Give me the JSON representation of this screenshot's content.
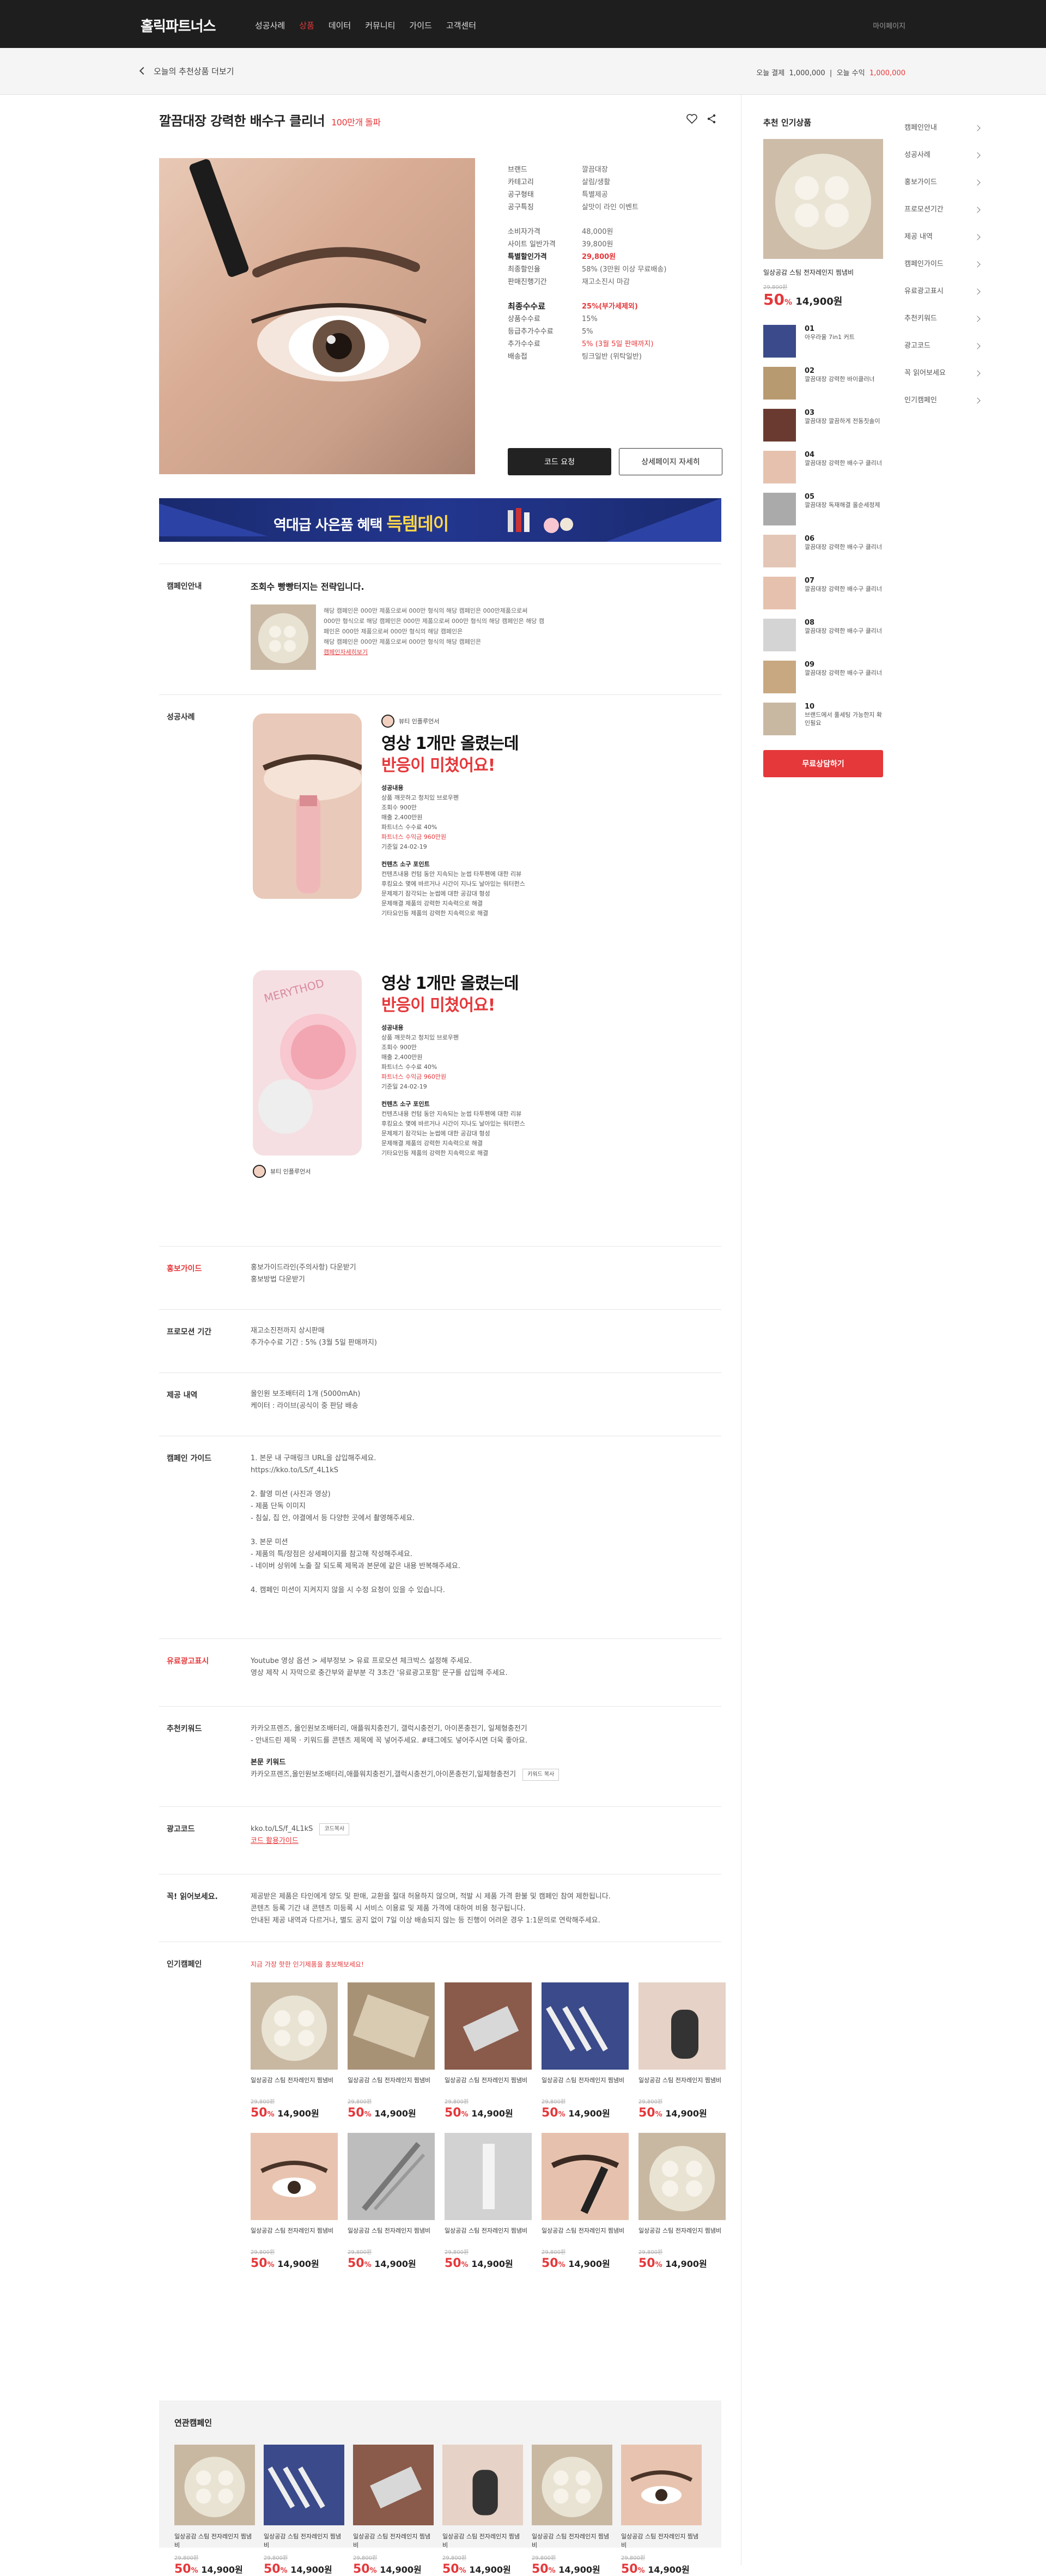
{
  "header": {
    "logo": "홀릭파트너스",
    "nav": [
      "성공사례",
      "상품",
      "데이터",
      "커뮤니티",
      "가이드",
      "고객센터"
    ],
    "active_nav": "상품",
    "login": "마이페이지"
  },
  "subbar": {
    "back_label": "오늘의 추천상품 더보기",
    "balance_label": "오늘 결제",
    "balance_value": "1,000,000",
    "today_label": "오늘 수익",
    "today_value": "1,000,000"
  },
  "product": {
    "title": "깔끔대장 강력한 배수구 클리너",
    "subtitle": "100만개 돌파",
    "info1": [
      {
        "k": "브랜드",
        "v": "깔끔대장"
      },
      {
        "k": "카테고리",
        "v": "살림/생활"
      },
      {
        "k": "공구형태",
        "v": "특별제공"
      },
      {
        "k": "공구특징",
        "v": "살맛이 라인 이벤트"
      }
    ],
    "info2": [
      {
        "k": "소비자가격",
        "v": "48,000원"
      },
      {
        "k": "사이트 일반가격",
        "v": "39,800원"
      },
      {
        "k": "특별할인가격",
        "v": "29,800원"
      },
      {
        "k": "최종할인율",
        "v": "58% (3만원 이상 무료배송)"
      },
      {
        "k": "판매진행기간",
        "v": "재고소진시 마감"
      }
    ],
    "info3": [
      {
        "k": "최종수수료",
        "v": "25%(부가세제외)"
      },
      {
        "k": "상품수수료",
        "v": "15%"
      },
      {
        "k": "등급추가수수료",
        "v": "5%"
      },
      {
        "k": "추가수수료",
        "v": "5% (3월 5일 판매까지)"
      },
      {
        "k": "배송접",
        "v": "팅크일반 (위탁일반)"
      }
    ],
    "btn_code": "코드 요청",
    "btn_detail": "상세페이지 자세히"
  },
  "banner": {
    "text": "역대급 사은품 혜택",
    "highlight": "득템데이"
  },
  "campaign": {
    "label": "캠페인안내",
    "title": "조회수 빵빵터지는 전략입니다.",
    "lines": [
      "해당 캠페인은 000만 제품으로써 000만 형식의 해당 캠페인은 000만제품으로써",
      "000만 형식으로 해당 캠페인은 000만 제품으로써 000만 형식의 해당 캠페인은 해당 캠",
      "페인은 000만 제품으로써 000만 형식의 해당 캠페인은",
      "해당 캠페인은 000만 제품으로써 000만 형식의 해당 캠페인은"
    ],
    "link": "캠페인자세히보기"
  },
  "success": {
    "label": "성공사례",
    "author": "뷰티 인플루언서",
    "cases": [
      {
        "hl1": "영상 1개만 올렸는데",
        "hl2": "반응이 미쳤어요!",
        "details_title": "성공내용",
        "details": [
          "상품   깨끗하고 청치있 브로우펜",
          "조회수   900만",
          "매출   2,400만원",
          "파트너스 수수료   40%"
        ],
        "red": [
          "파트너스 수익금   960만원"
        ],
        "date": "기준일   24-02-19",
        "point_title": "컨텐츠 소구 포인트",
        "points": [
          "컨텐츠내용 컨텀 동안 지속되는 눈썹 타투펜에 대한 리뷰",
          "후킹요소 몇에 바르거나 시간이 지나도 날아있는 워터펀스",
          "문제제기 잠각되는 눈썹에 대한 공감대 형성",
          "문제해결 제품의 강력한 지속력으로 해결",
          "기타요인등 제품의 강력한 지속력으로 해결"
        ]
      },
      {
        "hl1": "영상 1개만 올렸는데",
        "hl2": "반응이 미쳤어요!",
        "details_title": "성공내용",
        "details": [
          "상품   깨끗하고 청치있 브로우펜",
          "조회수   900만",
          "매출   2,400만원",
          "파트너스 수수료   40%"
        ],
        "red": [
          "파트너스 수익금   960만원"
        ],
        "date": "기준일   24-02-19",
        "point_title": "컨텐츠 소구 포인트",
        "points": [
          "컨텐츠내용 컨텀 동안 지속되는 눈썹 타투펜에 대한 리뷰",
          "후킹요소 몇에 바르거나 시간이 지나도 날아있는 워터펀스",
          "문제제기 잠각되는 눈썹에 대한 공감대 형성",
          "문제해결 제품의 강력한 지속력으로 해결",
          "기타요인등 제품의 강력한 지속력으로 해결"
        ]
      }
    ],
    "phone_top": "MERYTHOD"
  },
  "guide": {
    "label": "홍보가이드",
    "lines": [
      "홍보가이드라인(주의사항) 다운받기",
      "홍보방법 다운받기"
    ]
  },
  "promo": {
    "label": "프로모션 기간",
    "lines": [
      "재고소진전까지 상시판매",
      "추가수수료 기간 : 5% (3월 5일 판매까지)"
    ]
  },
  "provide": {
    "label": "제공 내역",
    "lines": [
      "올인원 보조배터리 1개 (5000mAh)",
      "케이터 : 라이브(공식이 중 판담 배송"
    ]
  },
  "campaign_guide": {
    "label": "캠페인 가이드",
    "lines": [
      "1. 본문 내 구매링크 URL을 삽입해주세요.",
      "https://kko.to/LS/f_4L1kS",
      "",
      "2. 촬영 미션 (사진과 영상)",
      "- 제품 단독 이미지",
      "- 침실, 집 안, 야결에서 등 다양한 곳에서 촬영해주세요.",
      "",
      "3. 본문 미션",
      "- 제품의 특/장점은 상세페이지를 참고해 작성해주세요.",
      "- 네이버 상위에 노출 잘 되도록 제목과 본문에 같은 내용 반복해주세요.",
      "",
      "4. 캠페인 미션이 지켜지지 않을 시 수정 요청이 있을 수 있습니다."
    ]
  },
  "ad_disclosure": {
    "label": "유료광고표시",
    "lines": [
      "Youtube 영상 옵션 > 세부정보 > 유료 프로모션 체크박스 설정해 주세요.",
      "영상 제작 시 자막으로 충간부와 끝부분 각 3초간 '유료광고포함' 문구를 삽입해 주세요."
    ]
  },
  "keywords": {
    "label": "추천키워드",
    "lines": [
      "카카오프렌즈, 올인원보조배터리, 애플워치충전기, 갤럭시충전기, 아이폰충전기, 일체형충전기",
      "- 안내드린 제목 · 키워드를 콘텐츠 제목에 꼭 넣어주세요. #태그에도 넣어주시면 더욱 좋아요."
    ],
    "sub_title": "본문 키워드",
    "sub_line": "카카오프렌즈,올인원보조배터리,애플워치충전기,갤럭시충전기,아이폰충전기,일체형충전기",
    "copy_btn": "키워드 복사"
  },
  "adcode": {
    "label": "광고코드",
    "code": "kko.to/LS/f_4L1kS",
    "copy_btn": "코드복사",
    "link": "코드 활용가이드"
  },
  "notice": {
    "label": "꼭! 읽어보세요.",
    "lines": [
      "제공받은 제품은 타인에게 양도 및 판매, 교환을 절대 허용하지 않으며, 적발 시 제품 가격 환불 및 캠페인 참여 제한됩니다.",
      "콘텐츠 등록 기간 내 콘텐츠 미등록 시 서비스 이용료 및 제품 가격에 대하여 비용 청구됩니다.",
      "안내된 제공 내역과 다르거나, 별도 공지 없이 7일 이상 배송되지 않는 등 진행이 어려운 경우 1:1문의로 연락해주세요."
    ]
  },
  "popular": {
    "label": "인기캠페인",
    "desc": "지금 가장 핫한 인기제품을 홍보해보세요!",
    "items_name": "일상공감 스팀 전자레인지 찜냄비",
    "items_orig": "29,800원",
    "items_pct": "50",
    "items_pct_unit": "%",
    "items_price": "14,900원",
    "count": 10
  },
  "related": {
    "title": "연관캠페인",
    "count": 6
  },
  "sidebar": {
    "title": "추천 인기상품",
    "main_name": "일상공감 스팀 전자레인지 찜냄비",
    "main_orig": "29,800원",
    "main_pct": "50",
    "main_price": "14,900원",
    "ranks": [
      {
        "n": "01",
        "t": "아우라울 7in1 커트"
      },
      {
        "n": "02",
        "t": "깔끔대장 강력한 바이클러너"
      },
      {
        "n": "03",
        "t": "깔끔대장 깔끔하게 전동칫솔이"
      },
      {
        "n": "04",
        "t": "깔끔대장 강력한 배수구 클리너"
      },
      {
        "n": "05",
        "t": "깔끔대장 독재해결 올순세정제"
      },
      {
        "n": "06",
        "t": "깔끔대장 강력한 배수구 클리너"
      },
      {
        "n": "07",
        "t": "깔끔대장 강력한 배수구 클리너"
      },
      {
        "n": "08",
        "t": "깔끔대장 강력한 배수구 클리너"
      },
      {
        "n": "09",
        "t": "깔끔대장 강력한 배수구 클리너"
      },
      {
        "n": "10",
        "t": "브랜드에서 풀세팅 가능한지 확인필요"
      }
    ],
    "cta": "무료상담하기"
  },
  "side_menu": [
    "캠페인안내",
    "성공사례",
    "홍보가이드",
    "프로모션기간",
    "제공 내역",
    "캠페인가이드",
    "유료광고표시",
    "추천키워드",
    "광고코드",
    "꼭 읽어보세요",
    "인기캠페인"
  ],
  "colors": {
    "accent": "#e5383b",
    "dark": "#1e1e1e"
  }
}
